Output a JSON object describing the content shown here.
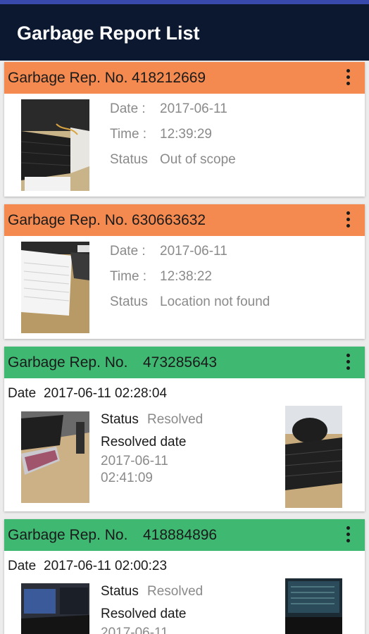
{
  "app": {
    "title": "Garbage Report List"
  },
  "labels": {
    "report_prefix": "Garbage Rep. No.",
    "date": "Date :",
    "time": "Time :",
    "status": "Status",
    "date_plain": "Date",
    "resolved_date": "Resolved date"
  },
  "reports": [
    {
      "number": "418212669",
      "date": "2017-06-11",
      "time": "12:39:29",
      "status": "Out of scope",
      "state": "pending"
    },
    {
      "number": "630663632",
      "date": "2017-06-11",
      "time": "12:38:22",
      "status": "Location not found",
      "state": "pending"
    },
    {
      "number": "473285643",
      "datetime": "2017-06-11 02:28:04",
      "status": "Resolved",
      "resolved_date": "2017-06-11",
      "resolved_time": "02:41:09",
      "state": "resolved"
    },
    {
      "number": "418884896",
      "datetime": "2017-06-11 02:00:23",
      "status": "Resolved",
      "resolved_date": "2017-06-11",
      "state": "resolved"
    }
  ],
  "colors": {
    "pending_header": "#f48a4f",
    "resolved_header": "#3fb872",
    "app_bar": "#0c1830"
  },
  "icons": {
    "menu": "more-vert-icon"
  }
}
